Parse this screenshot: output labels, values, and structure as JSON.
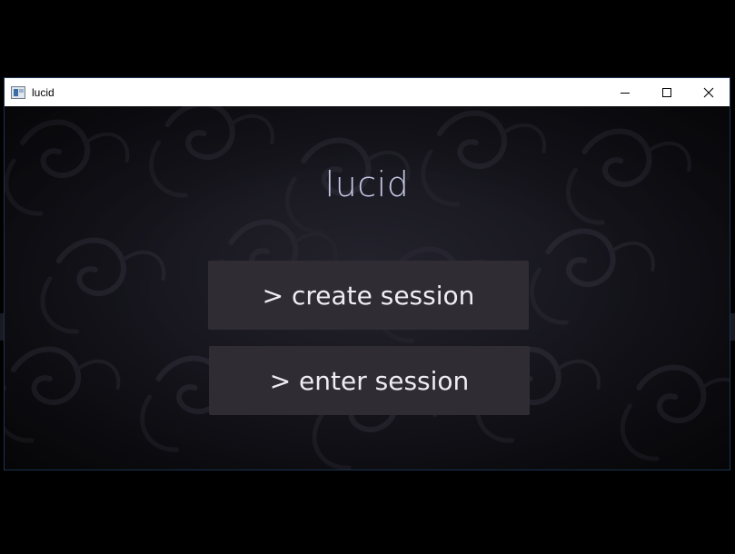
{
  "window": {
    "title": "lucid",
    "controls": [
      {
        "name": "minimize-icon"
      },
      {
        "name": "maximize-icon"
      },
      {
        "name": "close-icon"
      }
    ]
  },
  "main": {
    "app_title": "lucid",
    "buttons": {
      "create_session": "> create session",
      "enter_session": "> enter session"
    }
  },
  "colors": {
    "title_text": "#c7c8e6",
    "button_bg": "#2f2c34",
    "button_text": "#eeeef2",
    "background": "#17161e",
    "titlebar": "#ffffff"
  }
}
